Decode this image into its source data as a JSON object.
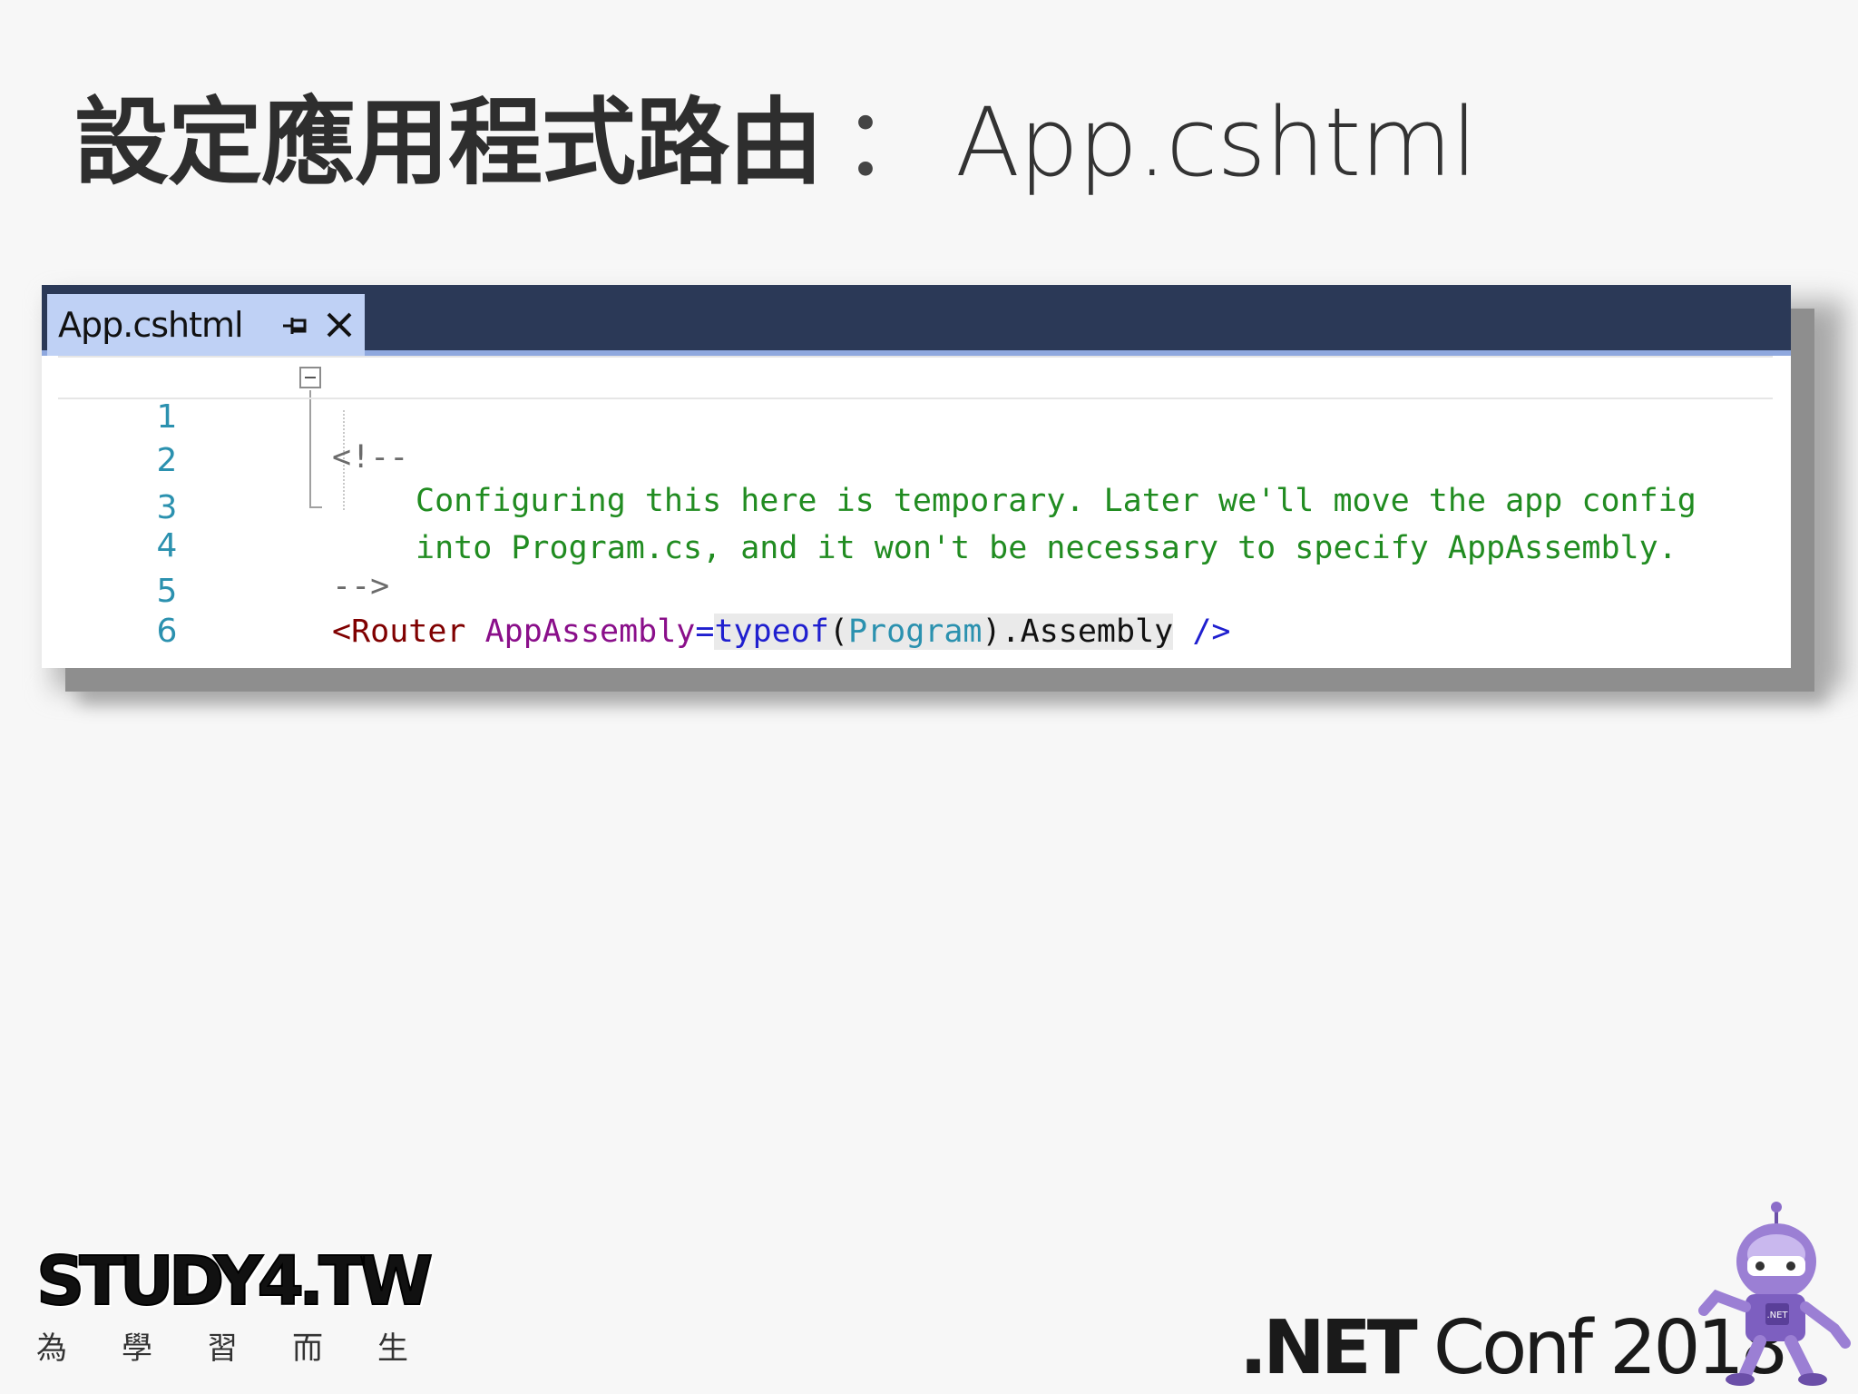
{
  "slide": {
    "title_zh": "設定應用程式路由",
    "title_sep": "：",
    "title_en": "App.cshtml"
  },
  "editor": {
    "tab_title": "App.cshtml",
    "tab_pin_icon": "pin-icon",
    "tab_close_icon": "close-icon",
    "lines": [
      {
        "num": "1",
        "comment_open": "<!--"
      },
      {
        "num": "2",
        "text": "Configuring this here is temporary. Later we'll move the app config"
      },
      {
        "num": "3",
        "text": "into Program.cs, and it won't be necessary to specify AppAssembly."
      },
      {
        "num": "4",
        "comment_close": "-->"
      },
      {
        "num": "5",
        "tag_open": "<Router",
        "attr": "AppAssembly",
        "eq": "=",
        "kw": "typeof",
        "paren_open": "(",
        "type": "Program",
        "paren_close": ")",
        "member": ".Assembly",
        "tag_close": "/>"
      },
      {
        "num": "6"
      }
    ]
  },
  "footer": {
    "study4_logo": "STUDY4.TW",
    "study4_tagline": [
      "為",
      "學",
      "習",
      "而",
      "生"
    ],
    "netconf_prefix": ".NET",
    "netconf_suffix": "Conf 2018",
    "mascot_badge": ".NET"
  }
}
